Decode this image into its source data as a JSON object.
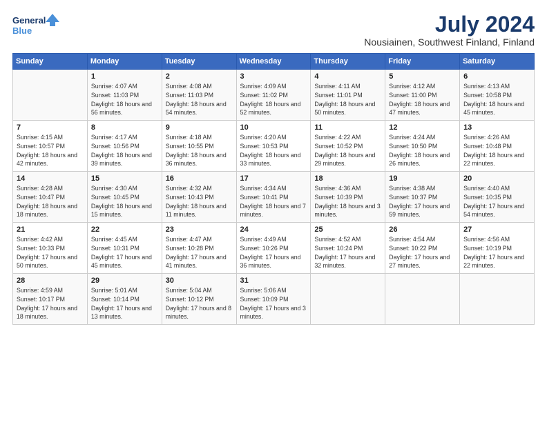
{
  "header": {
    "logo_line1": "General",
    "logo_line2": "Blue",
    "title": "July 2024",
    "subtitle": "Nousiainen, Southwest Finland, Finland"
  },
  "weekdays": [
    "Sunday",
    "Monday",
    "Tuesday",
    "Wednesday",
    "Thursday",
    "Friday",
    "Saturday"
  ],
  "weeks": [
    [
      {
        "day": "",
        "info": ""
      },
      {
        "day": "1",
        "info": "Sunrise: 4:07 AM\nSunset: 11:03 PM\nDaylight: 18 hours\nand 56 minutes."
      },
      {
        "day": "2",
        "info": "Sunrise: 4:08 AM\nSunset: 11:03 PM\nDaylight: 18 hours\nand 54 minutes."
      },
      {
        "day": "3",
        "info": "Sunrise: 4:09 AM\nSunset: 11:02 PM\nDaylight: 18 hours\nand 52 minutes."
      },
      {
        "day": "4",
        "info": "Sunrise: 4:11 AM\nSunset: 11:01 PM\nDaylight: 18 hours\nand 50 minutes."
      },
      {
        "day": "5",
        "info": "Sunrise: 4:12 AM\nSunset: 11:00 PM\nDaylight: 18 hours\nand 47 minutes."
      },
      {
        "day": "6",
        "info": "Sunrise: 4:13 AM\nSunset: 10:58 PM\nDaylight: 18 hours\nand 45 minutes."
      }
    ],
    [
      {
        "day": "7",
        "info": "Sunrise: 4:15 AM\nSunset: 10:57 PM\nDaylight: 18 hours\nand 42 minutes."
      },
      {
        "day": "8",
        "info": "Sunrise: 4:17 AM\nSunset: 10:56 PM\nDaylight: 18 hours\nand 39 minutes."
      },
      {
        "day": "9",
        "info": "Sunrise: 4:18 AM\nSunset: 10:55 PM\nDaylight: 18 hours\nand 36 minutes."
      },
      {
        "day": "10",
        "info": "Sunrise: 4:20 AM\nSunset: 10:53 PM\nDaylight: 18 hours\nand 33 minutes."
      },
      {
        "day": "11",
        "info": "Sunrise: 4:22 AM\nSunset: 10:52 PM\nDaylight: 18 hours\nand 29 minutes."
      },
      {
        "day": "12",
        "info": "Sunrise: 4:24 AM\nSunset: 10:50 PM\nDaylight: 18 hours\nand 26 minutes."
      },
      {
        "day": "13",
        "info": "Sunrise: 4:26 AM\nSunset: 10:48 PM\nDaylight: 18 hours\nand 22 minutes."
      }
    ],
    [
      {
        "day": "14",
        "info": "Sunrise: 4:28 AM\nSunset: 10:47 PM\nDaylight: 18 hours\nand 18 minutes."
      },
      {
        "day": "15",
        "info": "Sunrise: 4:30 AM\nSunset: 10:45 PM\nDaylight: 18 hours\nand 15 minutes."
      },
      {
        "day": "16",
        "info": "Sunrise: 4:32 AM\nSunset: 10:43 PM\nDaylight: 18 hours\nand 11 minutes."
      },
      {
        "day": "17",
        "info": "Sunrise: 4:34 AM\nSunset: 10:41 PM\nDaylight: 18 hours\nand 7 minutes."
      },
      {
        "day": "18",
        "info": "Sunrise: 4:36 AM\nSunset: 10:39 PM\nDaylight: 18 hours\nand 3 minutes."
      },
      {
        "day": "19",
        "info": "Sunrise: 4:38 AM\nSunset: 10:37 PM\nDaylight: 17 hours\nand 59 minutes."
      },
      {
        "day": "20",
        "info": "Sunrise: 4:40 AM\nSunset: 10:35 PM\nDaylight: 17 hours\nand 54 minutes."
      }
    ],
    [
      {
        "day": "21",
        "info": "Sunrise: 4:42 AM\nSunset: 10:33 PM\nDaylight: 17 hours\nand 50 minutes."
      },
      {
        "day": "22",
        "info": "Sunrise: 4:45 AM\nSunset: 10:31 PM\nDaylight: 17 hours\nand 45 minutes."
      },
      {
        "day": "23",
        "info": "Sunrise: 4:47 AM\nSunset: 10:28 PM\nDaylight: 17 hours\nand 41 minutes."
      },
      {
        "day": "24",
        "info": "Sunrise: 4:49 AM\nSunset: 10:26 PM\nDaylight: 17 hours\nand 36 minutes."
      },
      {
        "day": "25",
        "info": "Sunrise: 4:52 AM\nSunset: 10:24 PM\nDaylight: 17 hours\nand 32 minutes."
      },
      {
        "day": "26",
        "info": "Sunrise: 4:54 AM\nSunset: 10:22 PM\nDaylight: 17 hours\nand 27 minutes."
      },
      {
        "day": "27",
        "info": "Sunrise: 4:56 AM\nSunset: 10:19 PM\nDaylight: 17 hours\nand 22 minutes."
      }
    ],
    [
      {
        "day": "28",
        "info": "Sunrise: 4:59 AM\nSunset: 10:17 PM\nDaylight: 17 hours\nand 18 minutes."
      },
      {
        "day": "29",
        "info": "Sunrise: 5:01 AM\nSunset: 10:14 PM\nDaylight: 17 hours\nand 13 minutes."
      },
      {
        "day": "30",
        "info": "Sunrise: 5:04 AM\nSunset: 10:12 PM\nDaylight: 17 hours\nand 8 minutes."
      },
      {
        "day": "31",
        "info": "Sunrise: 5:06 AM\nSunset: 10:09 PM\nDaylight: 17 hours\nand 3 minutes."
      },
      {
        "day": "",
        "info": ""
      },
      {
        "day": "",
        "info": ""
      },
      {
        "day": "",
        "info": ""
      }
    ]
  ]
}
